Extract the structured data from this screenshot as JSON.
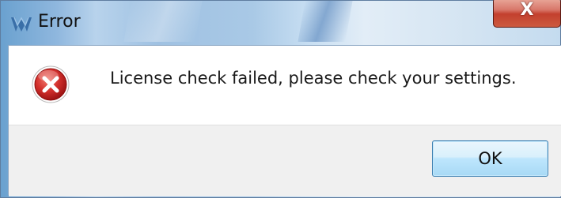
{
  "window": {
    "title": "Error",
    "close_glyph": "X"
  },
  "icons": {
    "app_icon": "app-logo-icon",
    "message_icon": "error-icon"
  },
  "dialog": {
    "message": "License check failed, please check your settings.",
    "ok_label": "OK"
  },
  "colors": {
    "close_button": "#c3402e",
    "error_icon": "#c8282a",
    "ok_button_border": "#3c7fb1"
  }
}
